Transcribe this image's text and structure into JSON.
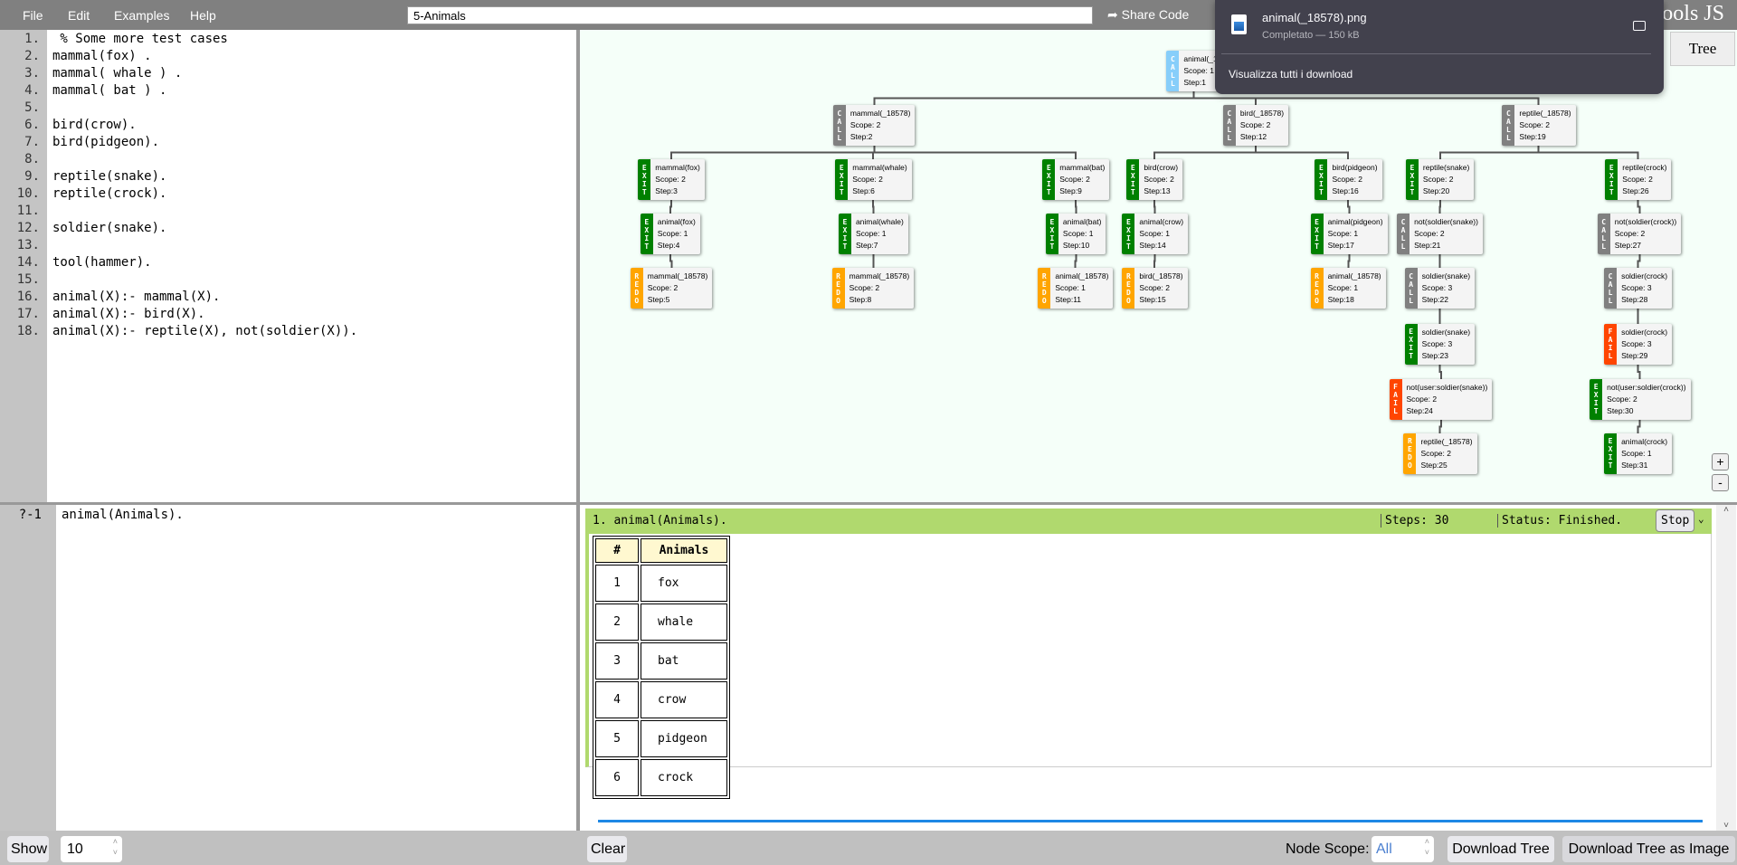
{
  "menu": [
    "File",
    "Edit",
    "Examples",
    "Help"
  ],
  "title_value": "5-Animals",
  "share_label": "Share Code",
  "brand_visible": "ools JS",
  "tree_tab": "Tree",
  "code_lines": [
    " % Some more test cases",
    "mammal(fox) .",
    "mammal( whale ) .",
    "mammal( bat ) .",
    "",
    "bird(crow).",
    "bird(pidgeon).",
    "",
    "reptile(snake).",
    "reptile(crock).",
    "",
    "soldier(snake).",
    "",
    "tool(hammer).",
    "",
    "animal(X):- mammal(X).",
    "animal(X):- bird(X).",
    "animal(X):- reptile(X), not(soldier(X))."
  ],
  "port_colors": {
    "CALL": "#808080",
    "ROOTCALL": "#87cefa",
    "EXIT": "#008000",
    "REDO": "#ffa500",
    "FAIL": "#ff4500"
  },
  "tree_nodes": [
    {
      "port": "CALL",
      "label": "animal(_1",
      "scope": "Scope: 1",
      "step": "Step:1",
      "root": true,
      "parent": null
    },
    {
      "port": "CALL",
      "label": "mammal(_18578)",
      "scope": "Scope: 2",
      "step": "Step:2",
      "parent": 0
    },
    {
      "port": "CALL",
      "label": "bird(_18578)",
      "scope": "Scope: 2",
      "step": "Step:12",
      "parent": 0
    },
    {
      "port": "CALL",
      "label": "reptile(_18578)",
      "scope": "Scope: 2",
      "step": "Step:19",
      "parent": 0
    },
    {
      "port": "EXIT",
      "label": "mammal(fox)",
      "scope": "Scope: 2",
      "step": "Step:3",
      "parent": 1
    },
    {
      "port": "EXIT",
      "label": "mammal(whale)",
      "scope": "Scope: 2",
      "step": "Step:6",
      "parent": 1
    },
    {
      "port": "EXIT",
      "label": "mammal(bat)",
      "scope": "Scope: 2",
      "step": "Step:9",
      "parent": 1
    },
    {
      "port": "EXIT",
      "label": "bird(crow)",
      "scope": "Scope: 2",
      "step": "Step:13",
      "parent": 2
    },
    {
      "port": "EXIT",
      "label": "bird(pidgeon)",
      "scope": "Scope: 2",
      "step": "Step:16",
      "parent": 2
    },
    {
      "port": "EXIT",
      "label": "reptile(snake)",
      "scope": "Scope: 2",
      "step": "Step:20",
      "parent": 3
    },
    {
      "port": "EXIT",
      "label": "reptile(crock)",
      "scope": "Scope: 2",
      "step": "Step:26",
      "parent": 3
    },
    {
      "port": "EXIT",
      "label": "animal(fox)",
      "scope": "Scope: 1",
      "step": "Step:4",
      "parent": 4
    },
    {
      "port": "EXIT",
      "label": "animal(whale)",
      "scope": "Scope: 1",
      "step": "Step:7",
      "parent": 5
    },
    {
      "port": "EXIT",
      "label": "animal(bat)",
      "scope": "Scope: 1",
      "step": "Step:10",
      "parent": 6
    },
    {
      "port": "EXIT",
      "label": "animal(crow)",
      "scope": "Scope: 1",
      "step": "Step:14",
      "parent": 7
    },
    {
      "port": "EXIT",
      "label": "animal(pidgeon)",
      "scope": "Scope: 1",
      "step": "Step:17",
      "parent": 8
    },
    {
      "port": "CALL",
      "label": "not(soldier(snake))",
      "scope": "Scope: 2",
      "step": "Step:21",
      "parent": 9
    },
    {
      "port": "CALL",
      "label": "not(soldier(crock))",
      "scope": "Scope: 2",
      "step": "Step:27",
      "parent": 10
    },
    {
      "port": "REDO",
      "label": "mammal(_18578)",
      "scope": "Scope: 2",
      "step": "Step:5",
      "parent": 11
    },
    {
      "port": "REDO",
      "label": "mammal(_18578)",
      "scope": "Scope: 2",
      "step": "Step:8",
      "parent": 12
    },
    {
      "port": "REDO",
      "label": "animal(_18578)",
      "scope": "Scope: 1",
      "step": "Step:11",
      "parent": 13
    },
    {
      "port": "REDO",
      "label": "bird(_18578)",
      "scope": "Scope: 2",
      "step": "Step:15",
      "parent": 14
    },
    {
      "port": "REDO",
      "label": "animal(_18578)",
      "scope": "Scope: 1",
      "step": "Step:18",
      "parent": 15
    },
    {
      "port": "CALL",
      "label": "soldier(snake)",
      "scope": "Scope: 3",
      "step": "Step:22",
      "parent": 16
    },
    {
      "port": "CALL",
      "label": "soldier(crock)",
      "scope": "Scope: 3",
      "step": "Step:28",
      "parent": 17
    },
    {
      "port": "EXIT",
      "label": "soldier(snake)",
      "scope": "Scope: 3",
      "step": "Step:23",
      "parent": 23
    },
    {
      "port": "FAIL",
      "label": "soldier(crock)",
      "scope": "Scope: 3",
      "step": "Step:29",
      "parent": 24
    },
    {
      "port": "FAIL",
      "label": "not(user:soldier(snake))",
      "scope": "Scope: 2",
      "step": "Step:24",
      "parent": 25
    },
    {
      "port": "EXIT",
      "label": "not(user:soldier(crock))",
      "scope": "Scope: 2",
      "step": "Step:30",
      "parent": 26
    },
    {
      "port": "REDO",
      "label": "reptile(_18578)",
      "scope": "Scope: 2",
      "step": "Step:25",
      "parent": 27
    },
    {
      "port": "EXIT",
      "label": "animal(crock)",
      "scope": "Scope: 1",
      "step": "Step:31",
      "parent": 28
    }
  ],
  "zoom": {
    "plus": "+",
    "minus": "-"
  },
  "download": {
    "filename": "animal(_18578).png",
    "status": "Completato — 150 kB",
    "view_all": "Visualizza tutti i download",
    "icon": "image-file-icon",
    "folder_icon": "folder-icon"
  },
  "query": {
    "prompt": "?-1",
    "text": "animal(Animals)."
  },
  "result": {
    "title": "1. animal(Animals).",
    "steps": "Steps: 30",
    "status": "Status: Finished.",
    "stop": "Stop",
    "columns": [
      "#",
      "Animals"
    ],
    "rows": [
      [
        "1",
        "fox"
      ],
      [
        "2",
        "whale"
      ],
      [
        "3",
        "bat"
      ],
      [
        "4",
        "crow"
      ],
      [
        "5",
        "pidgeon"
      ],
      [
        "6",
        "crock"
      ]
    ],
    "accent": "#b0d96e"
  },
  "toolbar": {
    "show": "Show",
    "count": "10",
    "clear": "Clear",
    "node_scope_label": "Node Scope:",
    "node_scope_value": "All",
    "download_tree": "Download Tree",
    "download_image": "Download Tree as Image"
  }
}
